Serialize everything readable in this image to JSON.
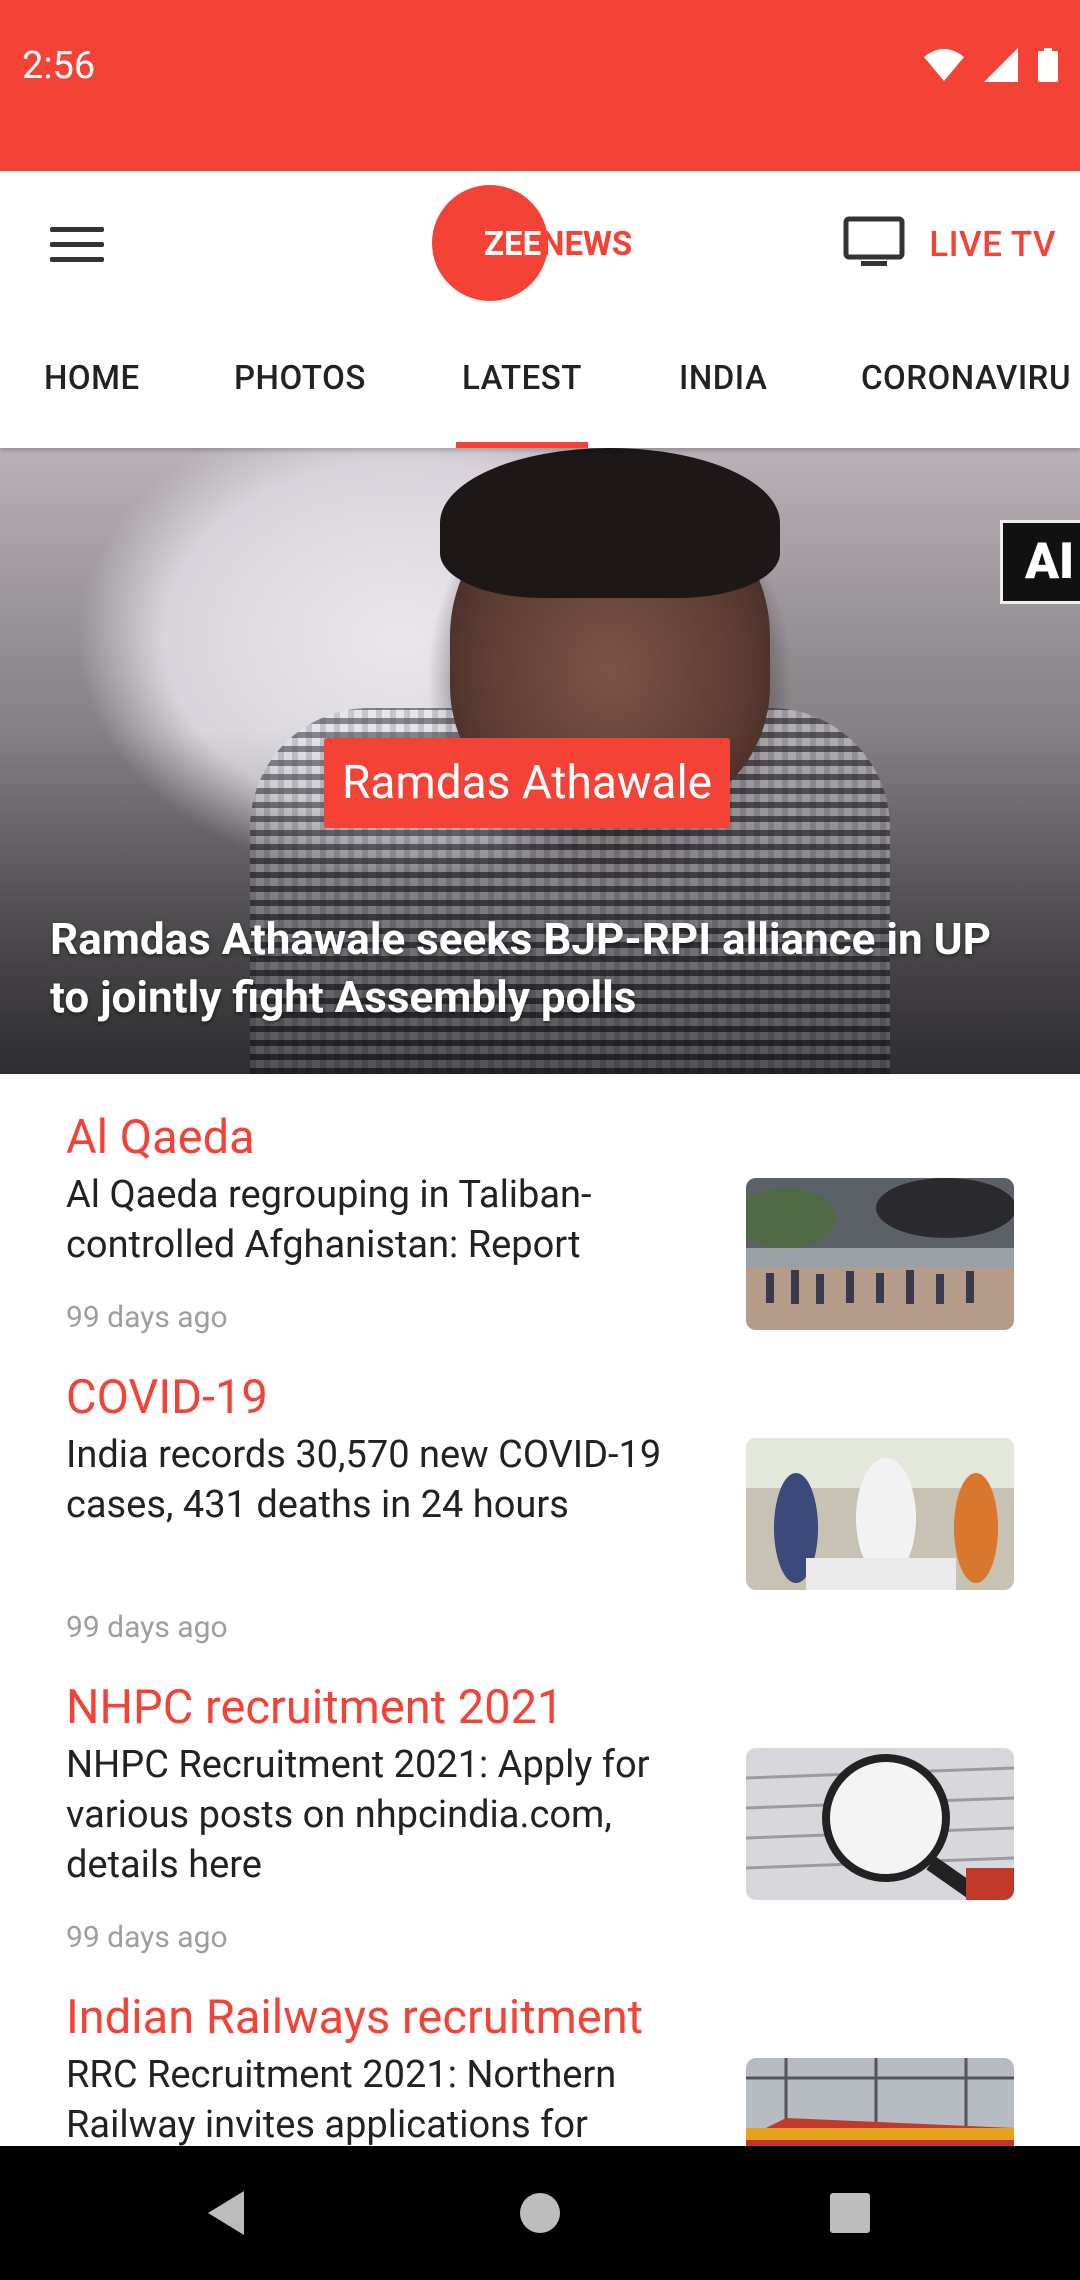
{
  "status_bar": {
    "time": "2:56",
    "icons": [
      "wifi-icon",
      "signal-icon",
      "battery-icon"
    ]
  },
  "app_bar": {
    "logo_zee": "ZEE",
    "logo_news": "NEWS",
    "live_tv_label": "LIVE TV",
    "brand_color": "#f44336"
  },
  "tabs": [
    {
      "label": "HOME",
      "active": false
    },
    {
      "label": "PHOTOS",
      "active": false
    },
    {
      "label": "LATEST",
      "active": true
    },
    {
      "label": "INDIA",
      "active": false
    },
    {
      "label": "CORONAVIRU",
      "active": false
    }
  ],
  "hero": {
    "tag": "Ramdas Athawale",
    "title": "Ramdas Athawale seeks BJP-RPI alliance in UP to jointly fight Assembly polls",
    "overlay_text": "AI"
  },
  "news_items": [
    {
      "category": "Al Qaeda",
      "headline": "Al Qaeda regrouping in Taliban-controlled Afghanistan: Report",
      "time": "99 days ago"
    },
    {
      "category": "COVID-19",
      "headline": "India records 30,570 new COVID-19 cases, 431 deaths in 24 hours",
      "time": "99 days ago"
    },
    {
      "category": "NHPC recruitment 2021",
      "headline": "NHPC Recruitment 2021: Apply for various posts on nhpcindia.com, details here",
      "time": "99 days ago"
    },
    {
      "category": "Indian Railways recruitment",
      "headline": "RRC Recruitment 2021: Northern Railway invites applications for",
      "time": ""
    }
  ],
  "nav_bar": {
    "buttons": [
      "back-icon",
      "home-icon",
      "recents-icon"
    ]
  }
}
